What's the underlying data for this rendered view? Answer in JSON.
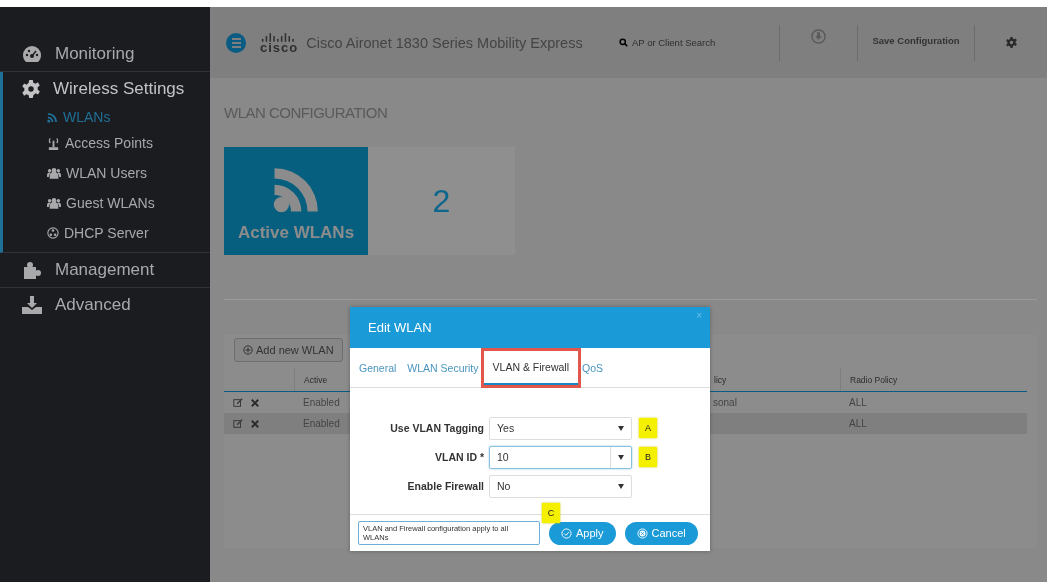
{
  "sidebar": {
    "items": [
      {
        "label": "Monitoring",
        "selected": false
      },
      {
        "label": "Wireless Settings",
        "selected": true,
        "children": [
          {
            "label": "WLANs",
            "selected": true
          },
          {
            "label": "Access Points",
            "selected": false
          },
          {
            "label": "WLAN Users",
            "selected": false
          },
          {
            "label": "Guest WLANs",
            "selected": false
          },
          {
            "label": "DHCP Server",
            "selected": false
          }
        ]
      },
      {
        "label": "Management",
        "selected": false
      },
      {
        "label": "Advanced",
        "selected": false
      }
    ]
  },
  "header": {
    "logo": "cisco",
    "title": "Cisco Aironet 1830 Series Mobility Express",
    "search": {
      "placeholder": "AP or Client Search"
    },
    "save_button": "Save Configuration"
  },
  "page": {
    "title": "WLAN CONFIGURATION",
    "tile": {
      "label": "Active WLANs",
      "count": "2"
    },
    "add_button": "Add new WLAN",
    "table": {
      "columns": [
        "Active",
        "licy",
        "Radio Policy"
      ],
      "rows": [
        {
          "active": "Enabled",
          "column_3": "sonal",
          "radio_policy": "ALL",
          "selected": false
        },
        {
          "active": "Enabled",
          "radio_policy": "ALL",
          "selected": true
        }
      ]
    }
  },
  "modal": {
    "title": "Edit WLAN",
    "close": "×",
    "tabs": [
      {
        "label": "General",
        "selected": false,
        "highlighted": false
      },
      {
        "label": "WLAN Security",
        "selected": false,
        "highlighted": false
      },
      {
        "label": "VLAN & Firewall",
        "selected": true,
        "highlighted": true
      },
      {
        "label": "QoS",
        "selected": false,
        "highlighted": false
      }
    ],
    "fields": [
      {
        "kind": "select",
        "label": "Use VLAN Tagging",
        "value": "Yes",
        "focused": false,
        "callout": "A"
      },
      {
        "kind": "combo",
        "label": "VLAN ID *",
        "value": "10",
        "focused": true,
        "callout": "B"
      },
      {
        "kind": "select",
        "label": "Enable Firewall",
        "value": "No",
        "focused": false
      }
    ],
    "note": "VLAN and Firewall configuration apply to all WLANs",
    "footer_callout": "C",
    "buttons": [
      {
        "kind": "apply",
        "label": "Apply"
      },
      {
        "kind": "cancel",
        "label": "Cancel"
      }
    ]
  }
}
